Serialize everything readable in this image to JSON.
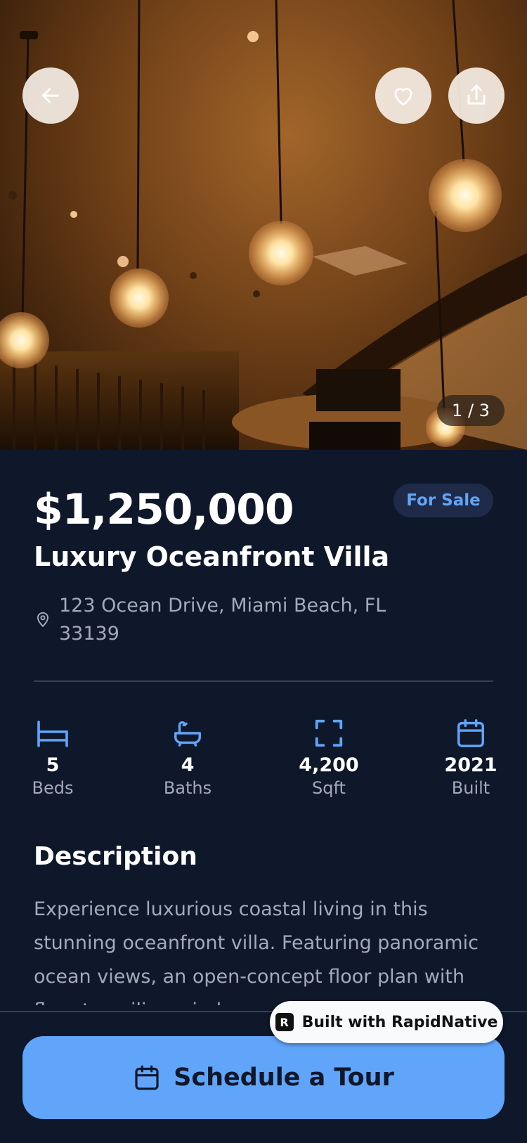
{
  "gallery": {
    "counter": "1 / 3",
    "back_icon": "arrow-left-icon",
    "favorite_icon": "heart-icon",
    "share_icon": "share-icon"
  },
  "listing": {
    "price": "$1,250,000",
    "status": "For Sale",
    "title": "Luxury Oceanfront Villa",
    "address": "123 Ocean Drive, Miami Beach, FL 33139"
  },
  "stats": [
    {
      "value": "5",
      "label": "Beds",
      "icon": "bed-icon"
    },
    {
      "value": "4",
      "label": "Baths",
      "icon": "bathtub-icon"
    },
    {
      "value": "4,200",
      "label": "Sqft",
      "icon": "area-icon"
    },
    {
      "value": "2021",
      "label": "Built",
      "icon": "calendar-icon"
    }
  ],
  "description": {
    "heading": "Description",
    "body": "Experience luxurious coastal living in this stunning oceanfront villa. Featuring panoramic ocean views, an open-concept floor plan with floor-to-ceiling windows, g"
  },
  "cta": {
    "label": "Schedule a Tour"
  },
  "watermark": {
    "label": "Built with RapidNative"
  },
  "colors": {
    "background": "#0f172a",
    "accent": "#60a5fa",
    "muted_text": "#a3aab8",
    "badge_bg": "#1e2a47"
  }
}
